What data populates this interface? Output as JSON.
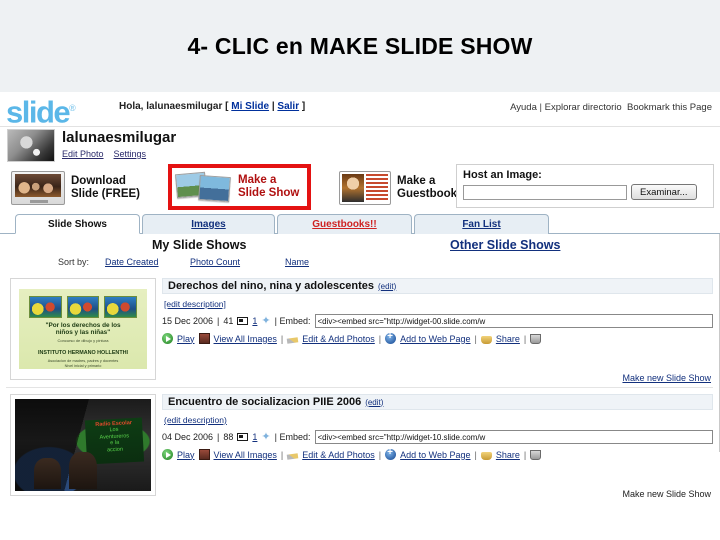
{
  "slide": {
    "title": "4- CLIC en MAKE SLIDE SHOW"
  },
  "header": {
    "logo": "slide",
    "logo_tm": "®",
    "greeting_prefix": "Hola, lalunaesmilugar [ ",
    "greeting_myslide": "Mi Slide",
    "greeting_divider": " | ",
    "greeting_logout": "Salir",
    "greeting_suffix": " ]",
    "help": "Ayuda",
    "divider": " | ",
    "explore": "Explorar directorio",
    "bookmark": "Bookmark this Page"
  },
  "profile": {
    "username": "lalunaesmilugar",
    "edit_photo": "Edit Photo",
    "settings": "Settings"
  },
  "actions": {
    "download": "Download\nSlide (FREE)",
    "make_slideshow": "Make a\nSlide Show",
    "make_guestbook": "Make a\nGuestbook",
    "highlight_color": "#e41212"
  },
  "host_image": {
    "label": "Host an Image:",
    "value": "",
    "placeholder": "",
    "browse_button": "Examinar..."
  },
  "tabs": [
    {
      "label": "Slide Shows",
      "active": true
    },
    {
      "label": "Images",
      "active": false
    },
    {
      "label": "Guestbooks!!",
      "active": false,
      "color": "#cf2222"
    },
    {
      "label": "Fan List",
      "active": false
    }
  ],
  "sections": {
    "my_slide_shows": "My Slide Shows",
    "other_slide_shows": "Other Slide Shows",
    "sort_by_label": "Sort by:",
    "sort_links": [
      "Date Created",
      "Photo Count",
      "Name"
    ]
  },
  "slideshows": [
    {
      "title": "Derechos del nino, nina y adolescentes",
      "edit_link": "(edit)",
      "edit_description": "[edit description]",
      "date": "15 Dec 2006",
      "divider": "|",
      "photo_count": "41",
      "fav_count": "1",
      "embed_label": "| Embed:",
      "embed_value": "<div><embed src=\"http://widget-00.slide.com/w",
      "actions": [
        "Play",
        "View All Images",
        "Edit & Add Photos",
        "Add to Web Page",
        "Share"
      ],
      "make_new": "Make new Slide Show",
      "thumb": {
        "line1": "\"Por los derechos de los",
        "line2": "niños y las niñas\"",
        "line3": "Concurso de dibujo y pintura",
        "line4": "INSTITUTO HERMANO HOLLENTHI",
        "line5": "Asociacion de madres, padres y docentes",
        "line6": "Nivel inicial y primario"
      }
    },
    {
      "title": "Encuentro de socializacion PIIE 2006",
      "edit_link": "(edit)",
      "edit_description": "(edit description)",
      "date": "04 Dec 2006",
      "divider": "|",
      "photo_count": "88",
      "fav_count": "1",
      "embed_label": "| Embed:",
      "embed_value": "<div><embed src=\"http://widget-10.slide.com/w",
      "actions": [
        "Play",
        "View All Images",
        "Edit & Add Photos",
        "Add to Web Page",
        "Share"
      ],
      "make_new": "Make new Slide Show",
      "thumb": {
        "sign_top": "Radio Escolar",
        "sign_l1": "Los",
        "sign_l2": "Aventureros",
        "sign_l3": "e la",
        "sign_l4": "accion"
      }
    }
  ]
}
